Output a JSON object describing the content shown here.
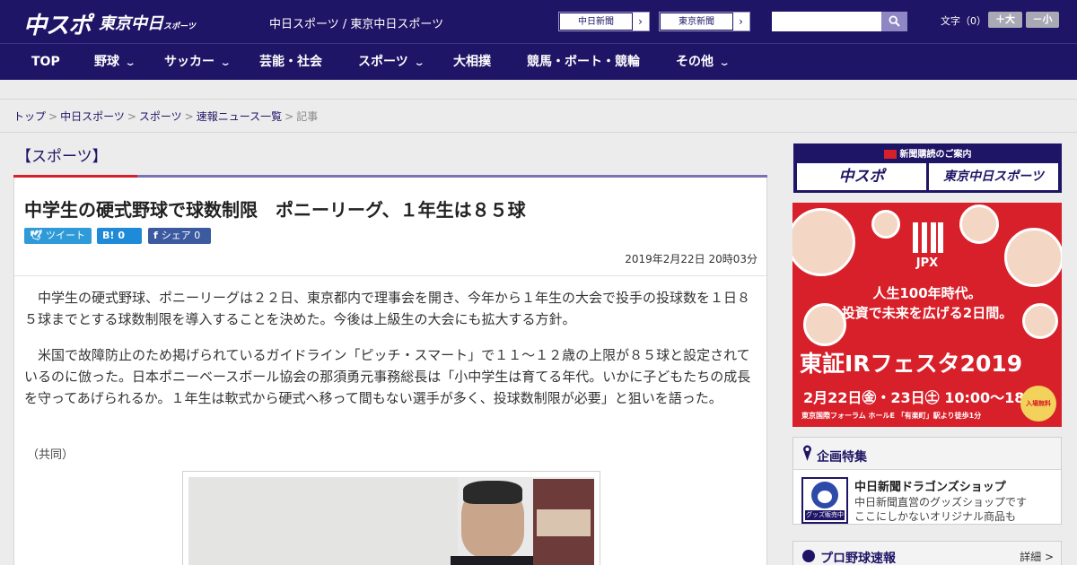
{
  "header": {
    "logo_chuspo": "中スポ",
    "logo_tokyo": "東京中日",
    "logo_tokyo_small": "スポーツ",
    "site_names": "中日スポーツ / 東京中日スポーツ",
    "paper_links": [
      {
        "label": "中日新聞",
        "arrow": "›"
      },
      {
        "label": "東京新聞",
        "arrow": "›"
      }
    ],
    "search_placeholder": "",
    "font_size_label": "文字（0）",
    "font_larger": "＋大",
    "font_smaller": "－小"
  },
  "nav": {
    "items": [
      {
        "label": "TOP",
        "chevron": ""
      },
      {
        "label": "野球",
        "chevron": "⌄"
      },
      {
        "label": "サッカー",
        "chevron": "⌄"
      },
      {
        "label": "芸能・社会",
        "chevron": ""
      },
      {
        "label": "スポーツ",
        "chevron": "⌄"
      },
      {
        "label": "大相撲",
        "chevron": ""
      },
      {
        "label": "競馬・ボート・競輪",
        "chevron": ""
      },
      {
        "label": "その他",
        "chevron": "⌄"
      }
    ]
  },
  "breadcrumb": {
    "items": [
      "トップ",
      "中日スポーツ",
      "スポーツ",
      "速報ニュース一覧"
    ],
    "current": "記事",
    "separator": ">"
  },
  "article": {
    "category": "【スポーツ】",
    "headline": "中学生の硬式野球で球数制限　ポニーリーグ、１年生は８５球",
    "share": {
      "tweet": "ツイート",
      "hatena_count": "0",
      "facebook_label": "シェア",
      "facebook_count": "0"
    },
    "date": "2019年2月22日 20時03分",
    "paragraphs": [
      "　中学生の硬式野球、ポニーリーグは２２日、東京都内で理事会を開き、今年から１年生の大会で投手の投球数を１日８５球までとする球数制限を導入することを決めた。今後は上級生の大会にも拡大する方針。",
      "　米国で故障防止のため掲げられているガイドライン「ピッチ・スマート」で１１～１２歳の上限が８５球と設定されているのに倣った。日本ポニーベースボール協会の那須勇元事務総長は「小中学生は育てる年代。いかに子どもたちの成長を守ってあげられるか。１年生は軟式から硬式へ移って間もない選手が多く、投球数制限が必要」と狙いを語った。"
    ],
    "credit": "（共同）"
  },
  "sidebar": {
    "subscription": {
      "title": "新聞購読のご案内",
      "card1": "中スポ",
      "card2": "東京中日スポーツ"
    },
    "ad": {
      "brand": "JPX",
      "tagline1": "人生100年時代。",
      "tagline2": "投資で未来を広げる2日間。",
      "event": "東証IRフェスタ2019",
      "dates": "2月22日㊎・23日㊏ 10:00～18:00",
      "venue": "東京国際フォーラム ホールE 「有楽町」駅より徒歩1分",
      "badge": "入場無料"
    },
    "feature": {
      "title": "企画特集",
      "thumb_label": "グッズ販売中",
      "item_title": "中日新聞ドラゴンズショップ",
      "item_desc_1": "中日新聞直営のグッズショップです",
      "item_desc_2": "ここにしかないオリジナル商品も"
    },
    "baseball": {
      "title": "プロ野球速報",
      "more": "詳細 >"
    }
  },
  "colors": {
    "brand_navy": "#1f1566",
    "accent_red": "#d6202a",
    "twitter_blue": "#2e9bd8",
    "hatena_blue": "#1f8ad8",
    "facebook_blue": "#3b5aa0"
  },
  "icons": [
    "search-icon",
    "twitter-icon",
    "hatena-icon",
    "facebook-icon",
    "ribbon-icon",
    "baseball-icon",
    "chevron-down-icon"
  ]
}
